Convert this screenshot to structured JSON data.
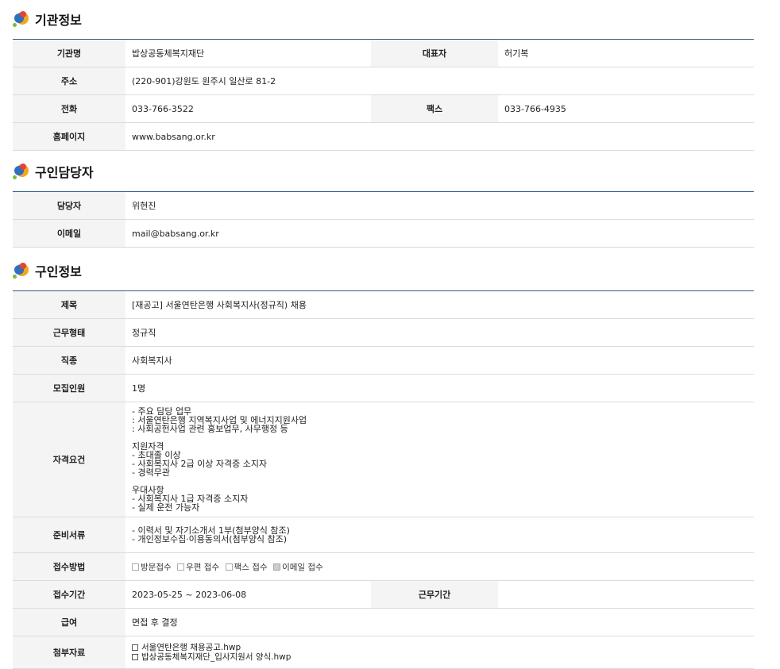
{
  "org": {
    "title": "기관정보",
    "name_label": "기관명",
    "name": "밥상공동체복지재단",
    "ceo_label": "대표자",
    "ceo": "허기복",
    "address_label": "주소",
    "address": "(220-901)강원도 원주시 일산로 81-2",
    "phone_label": "전화",
    "phone": "033-766-3522",
    "fax_label": "팩스",
    "fax": "033-766-4935",
    "homepage_label": "홈페이지",
    "homepage": "www.babsang.or.kr"
  },
  "contact": {
    "title": "구인담당자",
    "person_label": "담당자",
    "person": "위현진",
    "email_label": "이메일",
    "email": "mail@babsang.or.kr"
  },
  "job": {
    "title": "구인정보",
    "subject_label": "제목",
    "subject": "[재공고] 서울연탄은행 사회복지사(정규직) 채용",
    "worktype_label": "근무형태",
    "worktype": "정규직",
    "category_label": "직종",
    "category": "사회복지사",
    "headcount_label": "모집인원",
    "headcount": "1명",
    "qual_label": "자격요건",
    "qual": "- 주요 담당 업무\n: 서울연탄은행 지역복지사업 및 에너지지원사업\n: 사회공헌사업 관련 홍보업무, 사무행정 등\n\n 지원자격\n- 초대졸 이상\n- 사회복지사 2급 이상 자격증 소지자\n- 경력무관\n\n우대사항\n- 사회복지사 1급 자격증 소지자\n- 실제 운전 가능자",
    "docs_label": "준비서류",
    "docs": "- 이력서 및 자기소개서 1부(첨부양식 참조)\n- 개인정보수집·이용동의서(첨부양식 참조)",
    "apply_method_label": "접수방법",
    "apply_methods": [
      "방문접수",
      "우편 접수",
      "팩스 접수",
      "이메일 접수"
    ],
    "period_label": "접수기간",
    "period": "2023-05-25 ~ 2023-06-08",
    "work_period_label": "근무기간",
    "work_period": "",
    "salary_label": "급여",
    "salary": "면접 후 결정",
    "attach_label": "첨부자료",
    "attachments": [
      "서울연탄은행 채용공고.hwp",
      "밥상공동체복지재단_입사지원서 양식.hwp"
    ]
  }
}
